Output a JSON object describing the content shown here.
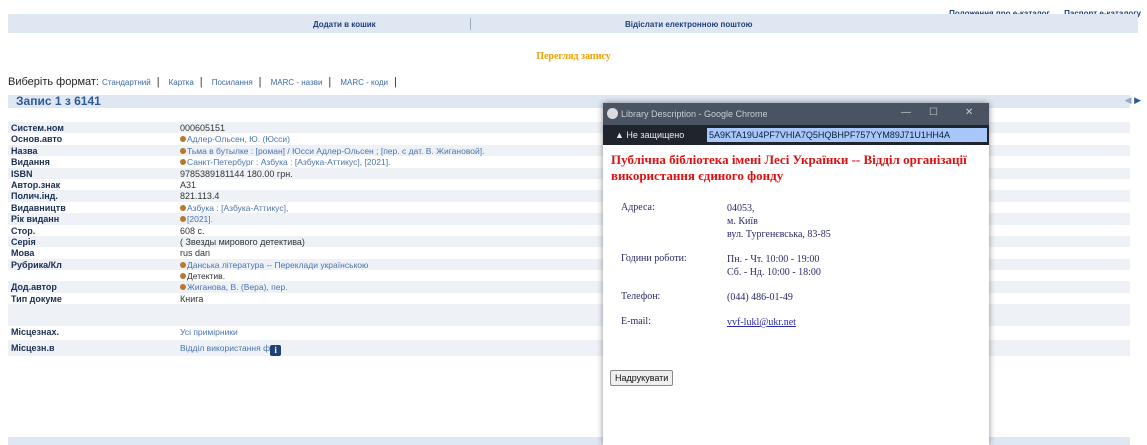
{
  "header": {
    "links": [
      "Положення про е-каталог",
      "Паспорт е-каталогу"
    ],
    "actions": [
      "Додати в кошик",
      "Відіслати електронною поштою"
    ]
  },
  "view_title": "Перегляд запису",
  "formats": {
    "label": "Виберіть формат:",
    "options": [
      "Стандартний",
      "Картка",
      "Посилання",
      "MARC - назви",
      "MARC - коди"
    ]
  },
  "record": {
    "title": "Запис 1 з 6141",
    "rows": [
      {
        "label": "Систем.ном",
        "value": "000605151"
      },
      {
        "label": "Основ.авто",
        "value": "Адлер-Ольсен, Ю. (Юсси)"
      },
      {
        "label": "Назва",
        "value": "Тьма в бутылке : [роман] / Юсси Адлер-Ольсен ; [пер. с дат. В. Жигановой]."
      },
      {
        "label": "Видання",
        "value": "Санкт-Петербург : Азбука : [Азбука-Аттикус], [2021]."
      },
      {
        "label": "ISBN",
        "value": "9785389181144 180.00 грн."
      },
      {
        "label": "Автор.знак",
        "value": "А31"
      },
      {
        "label": "Полич.інд.",
        "value": "821.113.4"
      },
      {
        "label": "Видавництв",
        "value": "Азбука : [Азбука-Аттикус],"
      },
      {
        "label": "Рік виданн",
        "value": "[2021]."
      },
      {
        "label": "Стор.",
        "value": "608 с."
      },
      {
        "label": "Серія",
        "value": "( Звезды мирового детектива)"
      },
      {
        "label": "Мова",
        "value": "rus dan"
      },
      {
        "label": "Рубрика/Кл",
        "value": "Данська література -- Переклади українською"
      },
      {
        "label": "",
        "value": "Детектив."
      },
      {
        "label": "Дод.автор",
        "value": "Жиганова, В. (Вера), пер."
      },
      {
        "label": "Тип докуме",
        "value": "Книга"
      },
      {
        "label": "Місцезнах.",
        "value": "Усі примірники"
      },
      {
        "label": "Місцезн.в",
        "value": "Відділ використання ф"
      }
    ]
  },
  "popup": {
    "window_title": "Library Description - Google Chrome",
    "not_secure": "Не защищено",
    "url": "5A9KTA19U4PF7VHIA7Q5HQBHPF757YYM89J71U1HH4A",
    "heading": "Публічна бібліотека імені Лесі Українки -- Відділ організації використання єдиного фонду",
    "address_label": "Адреса:",
    "address_lines": [
      "04053,",
      "м. Київ",
      "вул. Тургенєвська, 83-85"
    ],
    "hours_label": "Години роботи:",
    "hours_lines": [
      "Пн. - Чт. 10:00 - 19:00",
      "Сб. - Нд. 10:00 - 18:00"
    ],
    "phone_label": "Телефон:",
    "phone": "(044) 486-01-49",
    "email_label": "E-mail:",
    "email": "vvf-lukl@ukr.net",
    "print_button": "Надрукувати"
  }
}
